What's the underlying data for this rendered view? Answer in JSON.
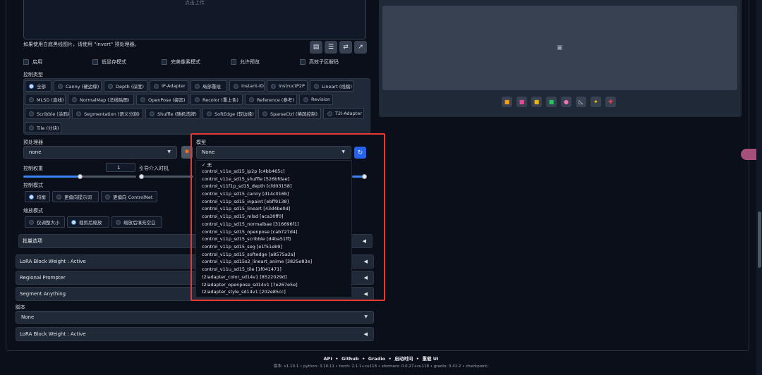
{
  "upload": {
    "text": "点击上传"
  },
  "note": "如果使用白底黑线图片，请使用 \"invert\" 预处理器。",
  "checkboxes": [
    "启用",
    "低显存模式",
    "完美像素模式",
    "允许预览",
    "高效子区解码"
  ],
  "control_type": {
    "label": "控制类型",
    "options": [
      "全部",
      "Canny (硬边缘)",
      "Depth (深度)",
      "IP-Adapter",
      "局部重绘",
      "Instant-ID",
      "InstructP2P",
      "Lineart (线稿)",
      "MLSD (直线)",
      "NormalMap (法线贴图)",
      "OpenPose (姿态)",
      "Recolor (重上色)",
      "Reference (参考)",
      "Revision",
      "Scribble (涂鸦)",
      "Segmentation (语义分割)",
      "Shuffle (随机洗牌)",
      "SoftEdge (软边缘)",
      "SparseCtrl (稀疏控制)",
      "T2I-Adapter",
      "Tile (分块)"
    ],
    "selected": "全部"
  },
  "preprocessor": {
    "label": "预处理器",
    "value": "none"
  },
  "model": {
    "label": "模型",
    "value": "None"
  },
  "control_weight": {
    "label": "控制权重",
    "value": "1"
  },
  "start_step": {
    "label": "引导介入时机"
  },
  "control_mode": {
    "label": "控制模式",
    "options": [
      "均衡",
      "更偏向提示词",
      "更偏向 ControlNet"
    ],
    "selected": "均衡"
  },
  "resize_mode": {
    "label": "缩放模式",
    "options": [
      "仅调整大小",
      "裁剪后缩放",
      "缩放后填充空白"
    ],
    "selected": "裁剪后缩放"
  },
  "model_dropdown": {
    "checked_item": "✓ 无",
    "items": [
      "control_v11e_sd15_ip2p [c4bb465c]",
      "control_v11e_sd15_shuffle [526bfdae]",
      "control_v11f1p_sd15_depth [cfd03158]",
      "control_v11p_sd15_canny [d14c016b]",
      "control_v11p_sd15_inpaint [ebff9138]",
      "control_v11p_sd15_lineart [43d4be0d]",
      "control_v11p_sd15_mlsd [aca30ff0]",
      "control_v11p_sd15_normalbae [316696f1]",
      "control_v11p_sd15_openpose [cab727d4]",
      "control_v11p_sd15_scribble [d4ba51ff]",
      "control_v11p_sd15_seg [e1f51eb9]",
      "control_v11p_sd15_softedge [a8575a2a]",
      "control_v11p_sd15s2_lineart_anime [3825e83e]",
      "control_v11u_sd15_tile [1f041471]",
      "t2iadapter_color_sd14v1 [8522029d]",
      "t2iadapter_openpose_sd14v1 [7e267e5e]",
      "t2iadapter_style_sd14v1 [202e85cc]"
    ]
  },
  "accordions": {
    "batch": "批量选项",
    "lora1": "LoRA Block Weight : Active",
    "regional": "Regional Prompter",
    "segment": "Segment Anything",
    "lora2": "LoRA Block Weight : Active"
  },
  "script": {
    "label": "脚本",
    "value": "None"
  },
  "footer": {
    "links": [
      "API",
      "Github",
      "Gradio",
      "启动时间",
      "重载 UI"
    ],
    "info": "版本: v1.10.1  •  python: 3.10.11  •  torch: 2.1.1+cu118  •  xformers: 0.0.27+cu118  •  gradio: 3.41.2  •  checkpoint:"
  }
}
